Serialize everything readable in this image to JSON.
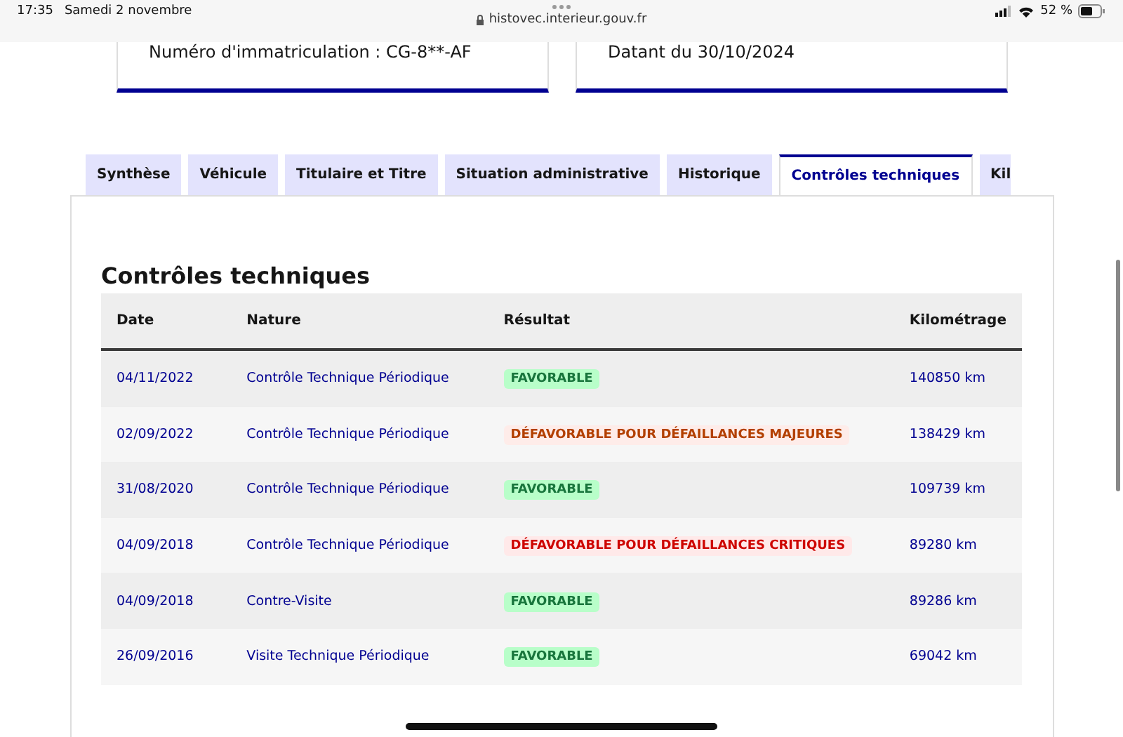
{
  "status_bar": {
    "time": "17:35",
    "date": "Samedi 2 novembre",
    "url": "histovec.interieur.gouv.fr",
    "battery": "52 %"
  },
  "cards": [
    {
      "text": "Numéro d'immatriculation : CG-8**-AF"
    },
    {
      "text": "Datant du 30/10/2024"
    }
  ],
  "tabs": [
    {
      "label": "Synthèse",
      "selected": false
    },
    {
      "label": "Véhicule",
      "selected": false
    },
    {
      "label": "Titulaire et Titre",
      "selected": false
    },
    {
      "label": "Situation administrative",
      "selected": false
    },
    {
      "label": "Historique",
      "selected": false
    },
    {
      "label": "Contrôles techniques",
      "selected": true
    },
    {
      "label": "Kil",
      "selected": false
    }
  ],
  "section_title": "Contrôles techniques",
  "table": {
    "columns": [
      "Date",
      "Nature",
      "Résultat",
      "Kilométrage"
    ],
    "rows": [
      {
        "date": "04/11/2022",
        "nature": "Contrôle Technique Périodique",
        "result": {
          "text": "FAVORABLE",
          "kind": "favorable"
        },
        "mileage": "140850 km"
      },
      {
        "date": "02/09/2022",
        "nature": "Contrôle Technique Périodique",
        "result": {
          "text": "DÉFAVORABLE POUR DÉFAILLANCES MAJEURES",
          "kind": "major"
        },
        "mileage": "138429 km"
      },
      {
        "date": "31/08/2020",
        "nature": "Contrôle Technique Périodique",
        "result": {
          "text": "FAVORABLE",
          "kind": "favorable"
        },
        "mileage": "109739 km"
      },
      {
        "date": "04/09/2018",
        "nature": "Contrôle Technique Périodique",
        "result": {
          "text": "DÉFAVORABLE POUR DÉFAILLANCES CRITIQUES",
          "kind": "critical"
        },
        "mileage": "89280 km"
      },
      {
        "date": "04/09/2018",
        "nature": "Contre-Visite",
        "result": {
          "text": "FAVORABLE",
          "kind": "favorable"
        },
        "mileage": "89286 km"
      },
      {
        "date": "26/09/2016",
        "nature": "Visite Technique Périodique",
        "result": {
          "text": "FAVORABLE",
          "kind": "favorable"
        },
        "mileage": "69042 km"
      }
    ]
  }
}
